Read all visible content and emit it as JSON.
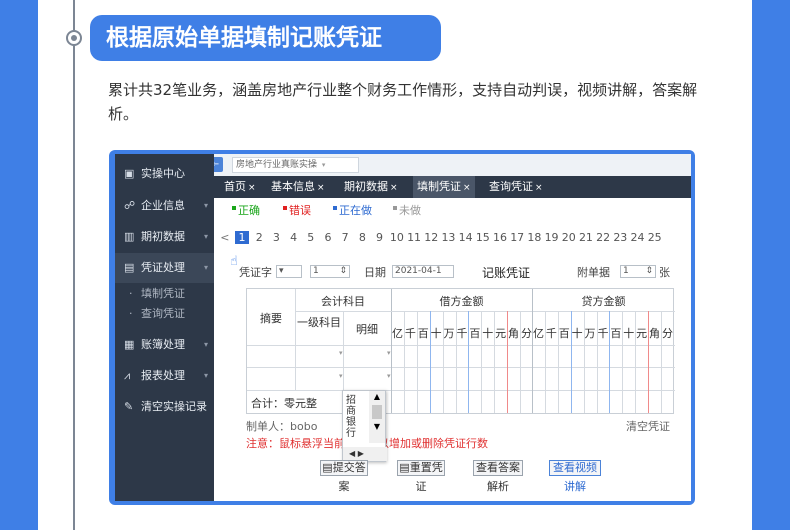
{
  "headline": "根据原始单据填制记账凭证",
  "intro": "累计共32笔业务，涵盖房地产行业整个财务工作情形，支持自动判误，视频讲解，答案解析。",
  "sidebar": {
    "items": [
      {
        "label": "实操中心",
        "icon": "clipboard-icon"
      },
      {
        "label": "企业信息",
        "icon": "users-icon"
      },
      {
        "label": "期初数据",
        "icon": "bar-chart-icon"
      },
      {
        "label": "凭证处理",
        "icon": "voucher-icon"
      },
      {
        "label": "账簿处理",
        "icon": "book-icon"
      },
      {
        "label": "报表处理",
        "icon": "line-chart-icon"
      },
      {
        "label": "清空实操记录",
        "icon": "brush-icon"
      }
    ],
    "sub_items": [
      "填制凭证",
      "查询凭证"
    ]
  },
  "industry_select": "房地产行业真账实操",
  "tabs": [
    "首页",
    "基本信息",
    "期初数据",
    "填制凭证",
    "查询凭证"
  ],
  "tab_close": "×",
  "legend": [
    {
      "label": "正确",
      "color": "#1aa51a"
    },
    {
      "label": "错误",
      "color": "#e02020"
    },
    {
      "label": "正在做",
      "color": "#2f6bd1"
    },
    {
      "label": "未做",
      "color": "#999999"
    }
  ],
  "pager": {
    "prev": "<",
    "current": "1",
    "pages": [
      "2",
      "3",
      "4",
      "5",
      "6",
      "7",
      "8",
      "9",
      "10",
      "11",
      "12",
      "13",
      "14",
      "15",
      "16",
      "17",
      "18",
      "19",
      "20",
      "21",
      "22",
      "23",
      "24",
      "25"
    ]
  },
  "voucher": {
    "word_label": "凭证字",
    "number": "1",
    "date_label": "日期",
    "date_value": "2021-04-1",
    "title": "记账凭证",
    "attach_label": "附单据",
    "attach_value": "1",
    "attach_unit": "张",
    "headers": {
      "summary": "摘要",
      "account": "会计科目",
      "level1": "一级科目",
      "detail": "明细",
      "debit": "借方金额",
      "credit": "贷方金额"
    },
    "digits": [
      "亿",
      "千",
      "百",
      "十",
      "万",
      "千",
      "百",
      "十",
      "元",
      "角",
      "分"
    ],
    "total": "合计：零元整",
    "maker": "制单人：bobo",
    "clear": "清空凭证",
    "note": "注意：鼠标悬浮当前行，可以增加或删除凭证行数",
    "popup_text": "招商银行"
  },
  "buttons": [
    {
      "line1": "提交答",
      "line2": "案"
    },
    {
      "line1": "重置凭",
      "line2": "证"
    },
    {
      "line1": "查看答案",
      "line2": "解析"
    },
    {
      "line1": "查看视频",
      "line2": "讲解"
    }
  ]
}
